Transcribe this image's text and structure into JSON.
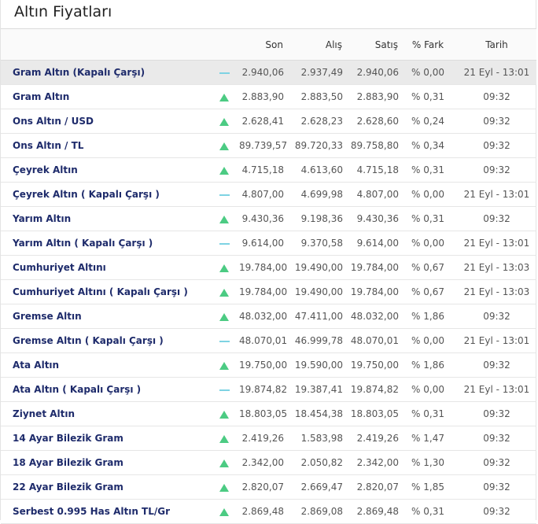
{
  "widget": {
    "title": "Altın Fiyatları"
  },
  "table": {
    "headers": {
      "son": "Son",
      "alis": "Alış",
      "satis": "Satış",
      "fark": "% Fark",
      "tarih": "Tarih"
    },
    "rows": [
      {
        "name": "Gram Altın (Kapalı Çarşı)",
        "trend": "neutral",
        "son": "2.940,06",
        "alis": "2.937,49",
        "satis": "2.940,06",
        "fark": "% 0,00",
        "tarih": "21 Eyl - 13:01"
      },
      {
        "name": "Gram Altın",
        "trend": "up",
        "son": "2.883,90",
        "alis": "2.883,50",
        "satis": "2.883,90",
        "fark": "% 0,31",
        "tarih": "09:32"
      },
      {
        "name": "Ons Altın / USD",
        "trend": "up",
        "son": "2.628,41",
        "alis": "2.628,23",
        "satis": "2.628,60",
        "fark": "% 0,24",
        "tarih": "09:32"
      },
      {
        "name": "Ons Altın / TL",
        "trend": "up",
        "son": "89.739,57",
        "alis": "89.720,33",
        "satis": "89.758,80",
        "fark": "% 0,34",
        "tarih": "09:32"
      },
      {
        "name": "Çeyrek Altın",
        "trend": "up",
        "son": "4.715,18",
        "alis": "4.613,60",
        "satis": "4.715,18",
        "fark": "% 0,31",
        "tarih": "09:32"
      },
      {
        "name": "Çeyrek Altın ( Kapalı Çarşı )",
        "trend": "neutral",
        "son": "4.807,00",
        "alis": "4.699,98",
        "satis": "4.807,00",
        "fark": "% 0,00",
        "tarih": "21 Eyl - 13:01"
      },
      {
        "name": "Yarım Altın",
        "trend": "up",
        "son": "9.430,36",
        "alis": "9.198,36",
        "satis": "9.430,36",
        "fark": "% 0,31",
        "tarih": "09:32"
      },
      {
        "name": "Yarım Altın ( Kapalı Çarşı )",
        "trend": "neutral",
        "son": "9.614,00",
        "alis": "9.370,58",
        "satis": "9.614,00",
        "fark": "% 0,00",
        "tarih": "21 Eyl - 13:01"
      },
      {
        "name": "Cumhuriyet Altını",
        "trend": "up",
        "son": "19.784,00",
        "alis": "19.490,00",
        "satis": "19.784,00",
        "fark": "% 0,67",
        "tarih": "21 Eyl - 13:03"
      },
      {
        "name": "Cumhuriyet Altını ( Kapalı Çarşı )",
        "trend": "up",
        "son": "19.784,00",
        "alis": "19.490,00",
        "satis": "19.784,00",
        "fark": "% 0,67",
        "tarih": "21 Eyl - 13:03"
      },
      {
        "name": "Gremse Altın",
        "trend": "up",
        "son": "48.032,00",
        "alis": "47.411,00",
        "satis": "48.032,00",
        "fark": "% 1,86",
        "tarih": "09:32"
      },
      {
        "name": "Gremse Altın ( Kapalı Çarşı )",
        "trend": "neutral",
        "son": "48.070,01",
        "alis": "46.999,78",
        "satis": "48.070,01",
        "fark": "% 0,00",
        "tarih": "21 Eyl - 13:01"
      },
      {
        "name": "Ata Altın",
        "trend": "up",
        "son": "19.750,00",
        "alis": "19.590,00",
        "satis": "19.750,00",
        "fark": "% 1,86",
        "tarih": "09:32"
      },
      {
        "name": "Ata Altın ( Kapalı Çarşı )",
        "trend": "neutral",
        "son": "19.874,82",
        "alis": "19.387,41",
        "satis": "19.874,82",
        "fark": "% 0,00",
        "tarih": "21 Eyl - 13:01"
      },
      {
        "name": "Ziynet Altın",
        "trend": "up",
        "son": "18.803,05",
        "alis": "18.454,38",
        "satis": "18.803,05",
        "fark": "% 0,31",
        "tarih": "09:32"
      },
      {
        "name": "14 Ayar Bilezik Gram",
        "trend": "up",
        "son": "2.419,26",
        "alis": "1.583,98",
        "satis": "2.419,26",
        "fark": "% 1,47",
        "tarih": "09:32"
      },
      {
        "name": "18 Ayar Bilezik Gram",
        "trend": "up",
        "son": "2.342,00",
        "alis": "2.050,82",
        "satis": "2.342,00",
        "fark": "% 1,30",
        "tarih": "09:32"
      },
      {
        "name": "22 Ayar Bilezik Gram",
        "trend": "up",
        "son": "2.820,07",
        "alis": "2.669,47",
        "satis": "2.820,07",
        "fark": "% 1,85",
        "tarih": "09:32"
      },
      {
        "name": "Serbest 0.995 Has Altın TL/Gr",
        "trend": "up",
        "son": "2.869,48",
        "alis": "2.869,08",
        "satis": "2.869,48",
        "fark": "% 0,31",
        "tarih": "09:32"
      }
    ]
  },
  "colors": {
    "up": "#4ccb83",
    "neutral": "#7ed3e3",
    "name_text": "#1e2b6b"
  }
}
